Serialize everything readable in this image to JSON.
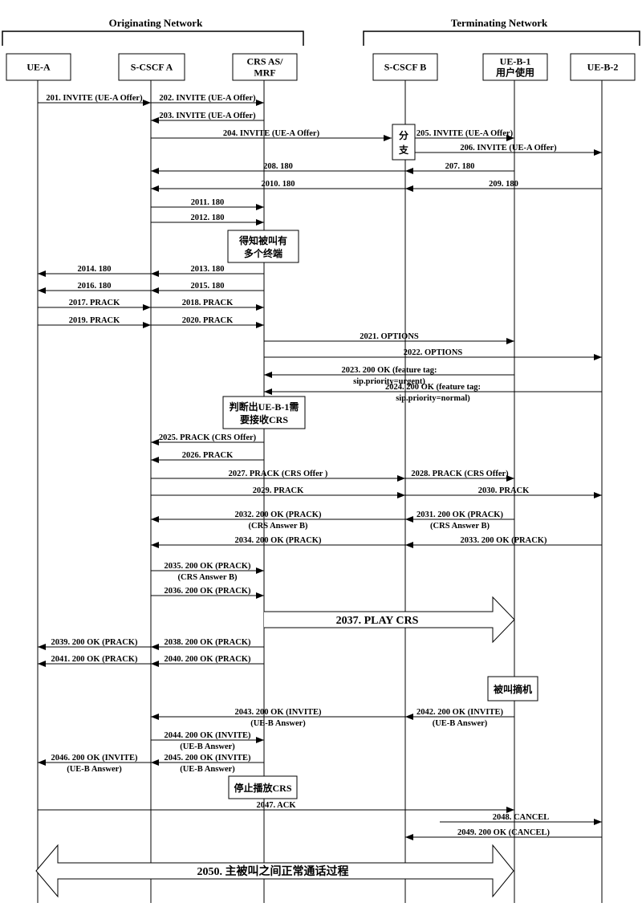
{
  "networks": [
    {
      "id": "orig",
      "title": "Originating Network",
      "from": "UE-A",
      "to": "CRS"
    },
    {
      "id": "term",
      "title": "Terminating Network",
      "from": "SB",
      "to": "UEB2"
    }
  ],
  "entities": [
    {
      "id": "UE-A",
      "lines": [
        "UE-A"
      ]
    },
    {
      "id": "SA",
      "lines": [
        "S-CSCF A"
      ]
    },
    {
      "id": "CRS",
      "lines": [
        "CRS AS/",
        "MRF"
      ]
    },
    {
      "id": "SB",
      "lines": [
        "S-CSCF B"
      ]
    },
    {
      "id": "UEB1",
      "lines": [
        "UE-B-1",
        "用户使用"
      ]
    },
    {
      "id": "UEB2",
      "lines": [
        "UE-B-2"
      ]
    }
  ],
  "messages": [
    {
      "n": "201",
      "label": "201. INVITE (UE-A Offer)",
      "from": "UE-A",
      "to": "SA",
      "row": 1
    },
    {
      "n": "202",
      "label": "202. INVITE (UE-A Offer)",
      "from": "SA",
      "to": "CRS",
      "row": 1
    },
    {
      "n": "203",
      "label": "203. INVITE (UE-A Offer)",
      "from": "CRS",
      "to": "SA",
      "row": 2
    },
    {
      "n": "204",
      "label": "204. INVITE (UE-A Offer)",
      "from": "SA",
      "to": "SB",
      "row": 3
    },
    {
      "n": "205",
      "label": "205. INVITE (UE-A Offer)",
      "from": "SB",
      "to": "UEB1",
      "row": 3
    },
    {
      "n": "206",
      "label": "206. INVITE (UE-A Offer)",
      "from": "SB",
      "to": "UEB2",
      "row": 4
    },
    {
      "n": "207",
      "label": "207. 180",
      "from": "UEB1",
      "to": "SB",
      "row": 5
    },
    {
      "n": "208",
      "label": "208. 180",
      "from": "SB",
      "to": "SA",
      "row": 5
    },
    {
      "n": "209",
      "label": "209. 180",
      "from": "UEB2",
      "to": "SB",
      "row": 6
    },
    {
      "n": "2010",
      "label": "2010. 180",
      "from": "SB",
      "to": "SA",
      "row": 6
    },
    {
      "n": "2011",
      "label": "2011. 180",
      "from": "SA",
      "to": "CRS",
      "row": 7
    },
    {
      "n": "2012",
      "label": "2012. 180",
      "from": "SA",
      "to": "CRS",
      "row": 8
    },
    {
      "n": "2013",
      "label": "2013. 180",
      "from": "CRS",
      "to": "SA",
      "row": 10
    },
    {
      "n": "2014",
      "label": "2014. 180",
      "from": "SA",
      "to": "UE-A",
      "row": 10
    },
    {
      "n": "2015",
      "label": "2015. 180",
      "from": "CRS",
      "to": "SA",
      "row": 11
    },
    {
      "n": "2016",
      "label": "2016. 180",
      "from": "SA",
      "to": "UE-A",
      "row": 11
    },
    {
      "n": "2017",
      "label": "2017. PRACK",
      "from": "UE-A",
      "to": "SA",
      "row": 12
    },
    {
      "n": "2018",
      "label": "2018. PRACK",
      "from": "SA",
      "to": "CRS",
      "row": 12
    },
    {
      "n": "2019",
      "label": "2019. PRACK",
      "from": "UE-A",
      "to": "SA",
      "row": 13
    },
    {
      "n": "2020",
      "label": "2020. PRACK",
      "from": "SA",
      "to": "CRS",
      "row": 13
    },
    {
      "n": "2021",
      "label": "2021. OPTIONS",
      "from": "CRS",
      "to": "UEB1",
      "row": 14
    },
    {
      "n": "2022",
      "label": "2022. OPTIONS",
      "from": "CRS",
      "to": "UEB2",
      "row": 15
    },
    {
      "n": "2023",
      "label": "2023. 200 OK (feature tag:",
      "label2": "sip.priority=urgent)",
      "from": "UEB1",
      "to": "CRS",
      "row": 16
    },
    {
      "n": "2024",
      "label": "2024. 200 OK (feature tag:",
      "label2": "sip.priority=normal)",
      "from": "UEB2",
      "to": "CRS",
      "row": 17
    },
    {
      "n": "2025",
      "label": "2025. PRACK (CRS Offer)",
      "from": "CRS",
      "to": "SA",
      "row": 19
    },
    {
      "n": "2026",
      "label": "2026. PRACK",
      "from": "CRS",
      "to": "SA",
      "row": 20
    },
    {
      "n": "2027",
      "label": "2027. PRACK (CRS Offer )",
      "from": "SA",
      "to": "SB",
      "row": 21
    },
    {
      "n": "2028",
      "label": "2028. PRACK (CRS Offer)",
      "from": "SB",
      "to": "UEB1",
      "row": 21
    },
    {
      "n": "2029",
      "label": "2029. PRACK",
      "from": "SA",
      "to": "SB",
      "row": 22
    },
    {
      "n": "2030",
      "label": "2030. PRACK",
      "from": "SB",
      "to": "UEB2",
      "row": 22
    },
    {
      "n": "2031",
      "label": "2031. 200 OK (PRACK)",
      "label2": "(CRS Answer B)",
      "from": "UEB1",
      "to": "SB",
      "row": 23
    },
    {
      "n": "2032",
      "label": "2032. 200 OK (PRACK)",
      "label2": "(CRS Answer B)",
      "from": "SB",
      "to": "SA",
      "row": 23
    },
    {
      "n": "2033",
      "label": "2033. 200 OK (PRACK)",
      "from": "UEB2",
      "to": "SB",
      "row": 24
    },
    {
      "n": "2034",
      "label": "2034. 200 OK (PRACK)",
      "from": "SB",
      "to": "SA",
      "row": 24
    },
    {
      "n": "2035",
      "label": "2035. 200 OK (PRACK)",
      "label2": "(CRS Answer B)",
      "from": "SA",
      "to": "CRS",
      "row": 25
    },
    {
      "n": "2036",
      "label": "2036. 200 OK (PRACK)",
      "from": "SA",
      "to": "CRS",
      "row": 26
    },
    {
      "n": "2038",
      "label": "2038. 200 OK (PRACK)",
      "from": "CRS",
      "to": "SA",
      "row": 28
    },
    {
      "n": "2039",
      "label": "2039. 200 OK (PRACK)",
      "from": "SA",
      "to": "UE-A",
      "row": 28
    },
    {
      "n": "2040",
      "label": "2040. 200 OK (PRACK)",
      "from": "CRS",
      "to": "SA",
      "row": 29
    },
    {
      "n": "2041",
      "label": "2041. 200 OK (PRACK)",
      "from": "SA",
      "to": "UE-A",
      "row": 29
    },
    {
      "n": "2042",
      "label": "2042. 200 OK (INVITE)",
      "label2": "(UE-B Answer)",
      "from": "UEB1",
      "to": "SB",
      "row": 31
    },
    {
      "n": "2043",
      "label": "2043. 200 OK (INVITE)",
      "label2": "(UE-B Answer)",
      "from": "SB",
      "to": "SA",
      "row": 31
    },
    {
      "n": "2044",
      "label": "2044. 200 OK (INVITE)",
      "label2": "(UE-B Answer)",
      "from": "SA",
      "to": "CRS",
      "row": 32
    },
    {
      "n": "2045",
      "label": "2045. 200 OK (INVITE)",
      "label2": "(UE-B Answer)",
      "from": "CRS",
      "to": "SA",
      "row": 33
    },
    {
      "n": "2046",
      "label": "2046. 200 OK (INVITE)",
      "label2": "(UE-B Answer)",
      "from": "SA",
      "to": "UE-A",
      "row": 33
    },
    {
      "n": "2047",
      "label": "2047. ACK",
      "from": "UE-A",
      "to": "UEB1",
      "row": 35
    },
    {
      "n": "2048",
      "label": "2048. CANCEL",
      "from": "UEB1",
      "to": "UEB2",
      "row": 36
    },
    {
      "n": "2049",
      "label": "2049. 200 OK (CANCEL)",
      "from": "UEB2",
      "to": "SB",
      "row": 37
    }
  ],
  "notes": [
    {
      "id": "fork",
      "lines": [
        "分",
        "支"
      ]
    },
    {
      "id": "multi-terminal",
      "lines": [
        "得知被叫有",
        "多个终端"
      ]
    },
    {
      "id": "decide-ueb1",
      "lines": [
        "判断出UE-B-1需",
        "要接收CRS"
      ]
    },
    {
      "id": "callee-answer",
      "lines": [
        "被叫摘机"
      ]
    },
    {
      "id": "stop-crs",
      "lines": [
        "停止播放CRS"
      ]
    }
  ],
  "big_arrows": [
    {
      "id": "play-crs",
      "label": "2037. PLAY CRS",
      "from": "CRS",
      "to": "UEB1",
      "direction": "right"
    },
    {
      "id": "normal-call",
      "label": "2050. 主被叫之间正常通话过程",
      "from": "UE-A",
      "to": "UEB1",
      "direction": "both"
    }
  ]
}
